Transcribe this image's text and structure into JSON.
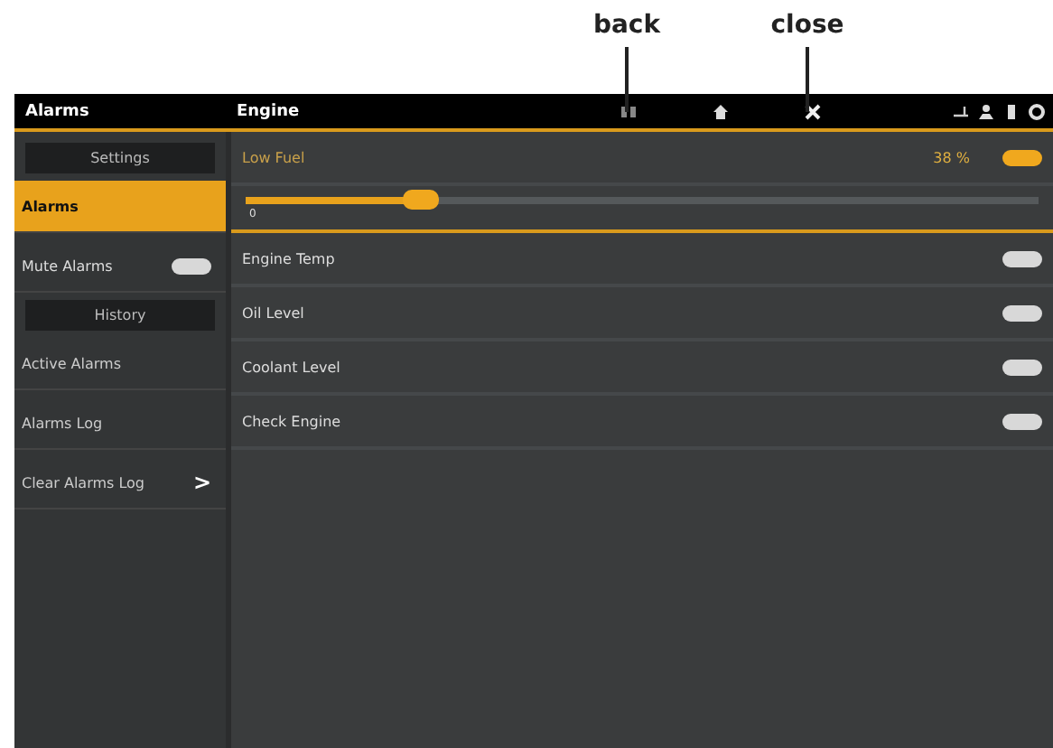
{
  "annotations": [
    {
      "label": "back"
    },
    {
      "label": "close"
    }
  ],
  "header": {
    "left_title": "Alarms",
    "title": "Engine"
  },
  "sidebar": {
    "items": [
      {
        "kind": "heading",
        "label": "Settings"
      },
      {
        "kind": "item",
        "label": "Alarms",
        "selected": true
      },
      {
        "kind": "toggle",
        "label": "Mute Alarms",
        "on": false,
        "selected": false
      },
      {
        "kind": "heading",
        "label": "History"
      },
      {
        "kind": "item",
        "label": "Active Alarms",
        "selected": false
      },
      {
        "kind": "item",
        "label": "Alarms Log",
        "selected": false
      },
      {
        "kind": "action",
        "label": "Clear Alarms Log",
        "arrow": ">",
        "selected": false
      }
    ]
  },
  "alarms": [
    {
      "kind": "slider",
      "label": "Low Fuel",
      "reading": "38 %",
      "on": true,
      "level": 0.22,
      "min": "0"
    },
    {
      "kind": "toggle",
      "label": "Engine Temp",
      "on": false
    },
    {
      "kind": "toggle",
      "label": "Oil Level",
      "on": false
    },
    {
      "kind": "toggle",
      "label": "Coolant Level",
      "on": false
    },
    {
      "kind": "toggle",
      "label": "Check Engine",
      "on": false
    }
  ]
}
